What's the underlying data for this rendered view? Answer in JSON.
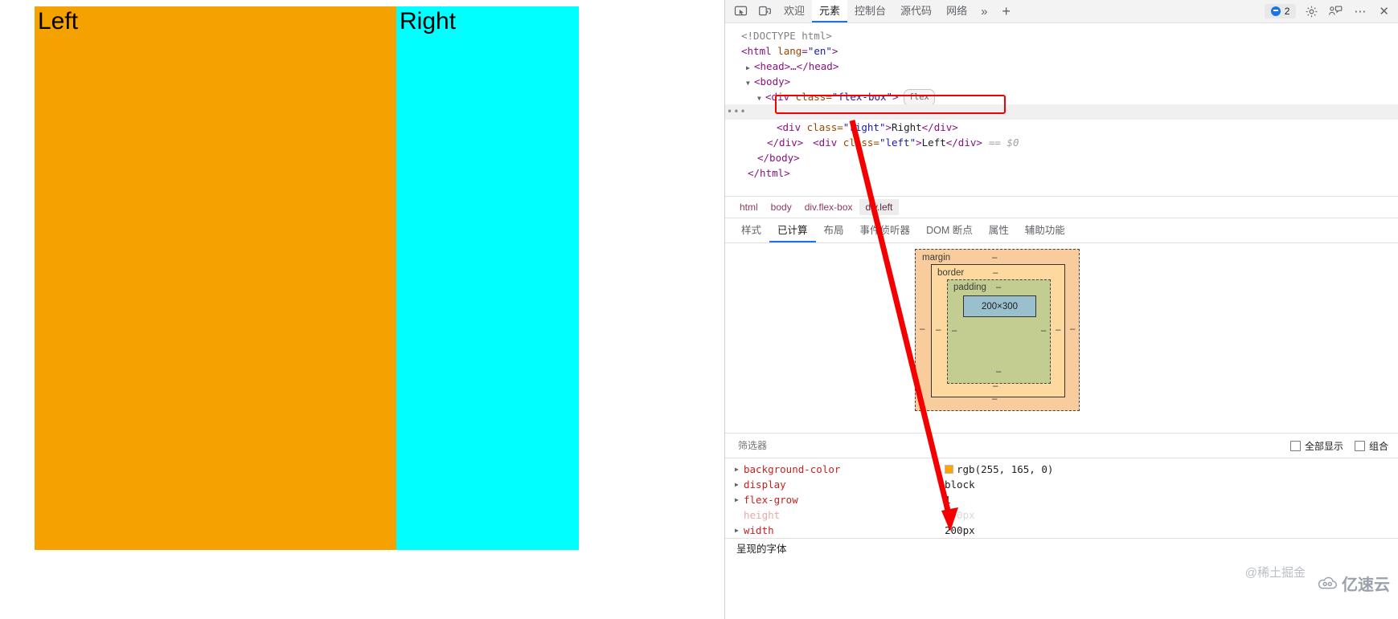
{
  "rendered_page": {
    "left_box": {
      "label": "Left",
      "color": "#f5a200"
    },
    "right_box": {
      "label": "Right",
      "color": "#00ffff"
    }
  },
  "devtools": {
    "toolbar": {
      "inspect_icon": "inspect-element-icon",
      "device_icon": "device-toolbar-icon",
      "tabs": [
        {
          "label": "欢迎",
          "active": false
        },
        {
          "label": "元素",
          "active": true
        },
        {
          "label": "控制台",
          "active": false
        },
        {
          "label": "源代码",
          "active": false
        },
        {
          "label": "网络",
          "active": false
        }
      ],
      "more_tabs": "»",
      "add_tab": "+",
      "issues_count": "2",
      "settings_icon": "gear-icon",
      "feedback_icon": "feedback-icon",
      "more_icon": "more-options-icon",
      "close_icon": "close-icon"
    },
    "dom_tree": {
      "lines": [
        {
          "text": "<!DOCTYPE html>"
        },
        {
          "text": "<html lang=\"en\">"
        },
        {
          "text": "<head>…</head>"
        },
        {
          "text": "<body>"
        },
        {
          "text": "<div class=\"flex-box\">",
          "badge": "flex"
        },
        {
          "text": "<div class=\"left\">Left</div>",
          "marker": "== $0",
          "selected": true,
          "gutter": "•••"
        },
        {
          "text": "<div class=\"right\">Right</div>"
        },
        {
          "text": "</div>"
        },
        {
          "text": "</body>"
        },
        {
          "text": "</html>"
        }
      ],
      "parts": {
        "doctype": "<!DOCTYPE html>",
        "html_open_tag": "<html",
        "html_attr_name": "lang",
        "html_attr_value": "\"en\"",
        "head_line": "<head>…</head>",
        "body_line": "<body>",
        "flexbox_tag_open": "<div ",
        "flexbox_attr": "class=",
        "flexbox_class": "\"flex-box\"",
        "flexbox_close": ">",
        "flex_badge": "flex",
        "left_class": "\"left\"",
        "left_text": "Left",
        "right_class": "\"right\"",
        "right_text": "Right",
        "selected_marker": "== $0",
        "div_close": "</div>",
        "body_close": "</body>",
        "html_close": "</html>",
        "gutter_ellipsis": "•••"
      }
    },
    "breadcrumb": [
      {
        "label": "html",
        "active": false
      },
      {
        "label": "body",
        "active": false
      },
      {
        "label": "div.flex-box",
        "active": false
      },
      {
        "label": "div.left",
        "active": true
      }
    ],
    "subtabs": [
      {
        "label": "样式",
        "active": false
      },
      {
        "label": "已计算",
        "active": true
      },
      {
        "label": "布局",
        "active": false
      },
      {
        "label": "事件侦听器",
        "active": false
      },
      {
        "label": "DOM 断点",
        "active": false
      },
      {
        "label": "属性",
        "active": false
      },
      {
        "label": "辅助功能",
        "active": false
      }
    ],
    "box_model": {
      "margin_label": "margin",
      "border_label": "border",
      "padding_label": "padding",
      "content_label": "200×300",
      "dash": "–"
    },
    "filter": {
      "placeholder": "筛选器",
      "value": "",
      "show_all_label": "全部显示",
      "show_all_checked": false,
      "group_label": "组合",
      "group_checked": false
    },
    "computed_properties": [
      {
        "name": "background-color",
        "value": "rgb(255, 165, 0)",
        "swatch": "#ffa500",
        "inherited": false,
        "expandable": true
      },
      {
        "name": "display",
        "value": "block",
        "inherited": false,
        "expandable": true
      },
      {
        "name": "flex-grow",
        "value": "1",
        "inherited": false,
        "expandable": true
      },
      {
        "name": "height",
        "value": "300px",
        "inherited": true,
        "expandable": false
      },
      {
        "name": "width",
        "value": "200px",
        "inherited": false,
        "expandable": true
      }
    ],
    "fonts_section": "呈现的字体"
  },
  "watermarks": {
    "primary": "@稀土掘金",
    "secondary": "亿速云"
  },
  "annotation": {
    "arrow_color": "#f50000"
  }
}
